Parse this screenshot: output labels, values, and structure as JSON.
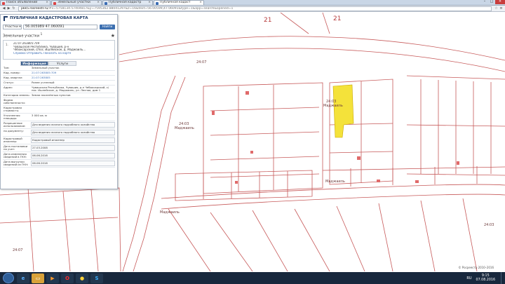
{
  "browser": {
    "tabs": [
      {
        "label": "Поиск объявлений",
        "active": false
      },
      {
        "label": "Земельные участки",
        "active": false
      },
      {
        "label": "Публичная кадастр",
        "active": false
      },
      {
        "label": "Публичная кадаст",
        "active": true
      }
    ],
    "url_host": "pkk5.rosreestr.ru",
    "url_rest": "/#x=5758134.57404817&y=7595362.88041297&z=16&text=56.00599,47.06091&type=1&app=search&opened=1"
  },
  "map": {
    "labels": {
      "block_21": "21",
      "block_21_top": "21",
      "mad_label_1": "Маджаиль",
      "mad_code_1": "24:03",
      "mad_label_2": "Маджаиль",
      "mad_code_2": "24:03",
      "mad_label_3": "Маджаиль",
      "mad_label_4": "Маджаиль",
      "code_left": "24:07",
      "code_mid": "24:03",
      "code_right": "24:03",
      "code_bottom": "24:07"
    },
    "highlight_color": "#f4e23a",
    "line_color": "#c75a5a"
  },
  "panel": {
    "title": "ПУБЛИЧНАЯ КАДАСТРОВАЯ КАРТА",
    "search_type": "Участки",
    "search_value": "56.005989 47.060091",
    "search_button": "Найти",
    "layer_title": "Земельные участки",
    "layer_count": "1",
    "result": {
      "index": "1.",
      "lines": [
        "21:07:263805:709",
        "Чувашская Республика, Чувашия, р-н",
        "Чебоксарский, с/пос. Ишлейское, д. Маджаиль...",
        "Справка  Отправить  Показать на карте"
      ]
    },
    "tabs": [
      "Информация",
      "Услуги"
    ],
    "info": [
      {
        "k": "Тип:",
        "v": "Земельный участок"
      },
      {
        "k": "Кад. номер:",
        "v": "21:07:263805:709"
      },
      {
        "k": "Кад. квартал:",
        "v": "21:07:263805"
      },
      {
        "k": "Статус:",
        "v": "Ранее учтенный"
      },
      {
        "k": "Адрес:",
        "v": "Чувашская Республика, Чувашия, р-н Чебоксарский, с/пос. Ишлейское, д. Маджаиль, ул. Лесная, дом 1"
      },
      {
        "k": "Категория земель:",
        "v": "Земли населённых пунктов"
      },
      {
        "k": "Форма собственности:",
        "v": ""
      },
      {
        "k": "Кадастровая стоимость:",
        "v": ""
      },
      {
        "k": "Уточненная площадь:",
        "v": "3 000 кв. м"
      },
      {
        "k": "Разрешенное использование:",
        "v": "Для ведения личного подсобного хозяйства"
      },
      {
        "k": "по документу:",
        "v": "Для ведения личного подсобного хозяйства"
      },
      {
        "k": "Кадастровый инженер:",
        "v": "Кадастровый инженер"
      },
      {
        "k": "Дата постановки на учет:",
        "v": "27.03.2008"
      },
      {
        "k": "Дата изменения сведений в ГКН:",
        "v": "06.06.2016"
      },
      {
        "k": "Дата выгрузки сведений из ГКН:",
        "v": "06.06.2016"
      }
    ]
  },
  "status_text": "© Росреестр 2010–2016",
  "taskbar": {
    "lang": "RU",
    "time": "9:15",
    "date": "07.08.2016"
  }
}
